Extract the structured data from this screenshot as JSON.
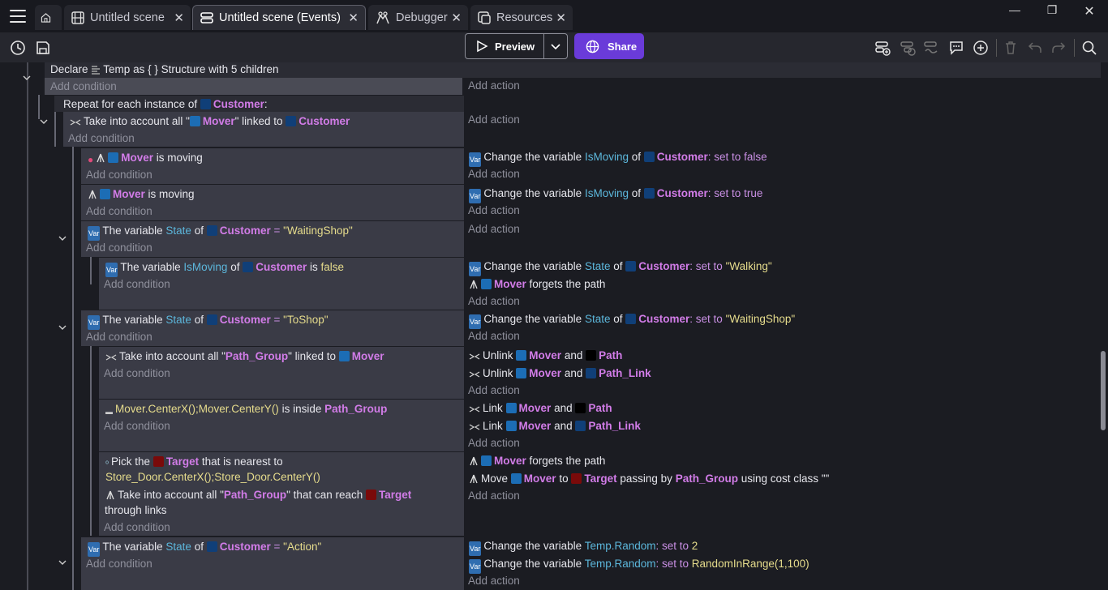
{
  "tabs": [
    {
      "label": "Untitled scene"
    },
    {
      "label": "Untitled scene (Events)"
    },
    {
      "label": "Debugger"
    },
    {
      "label": "Resources"
    }
  ],
  "toolbar": {
    "preview_label": "Preview",
    "share_label": "Share"
  },
  "events": {
    "declare": {
      "prefix": "Declare",
      "name": "Temp",
      "mid": "as",
      "struct": "{ }",
      "suffix": "Structure with 5 children"
    },
    "repeat": {
      "prefix": "Repeat for each instance of",
      "obj": "Customer",
      "suffix": ":"
    },
    "take_all": {
      "prefix": "Take into account all \"",
      "obj1": "Mover",
      "mid": "\" linked to",
      "obj2": "Customer"
    },
    "add_condition": "Add condition",
    "add_action": "Add action",
    "rows": {
      "r1": {
        "cond_obj": "Mover",
        "cond_text": "is moving",
        "act_prefix": "Change the variable",
        "act_var": "IsMoving",
        "act_of": "of",
        "act_obj": "Customer",
        "act_set": ": set to false"
      },
      "r2": {
        "cond_obj": "Mover",
        "cond_text": "is moving",
        "act_prefix": "Change the variable",
        "act_var": "IsMoving",
        "act_of": "of",
        "act_obj": "Customer",
        "act_set": ": set to true"
      },
      "r3": {
        "cond_prefix": "The variable",
        "cond_var": "State",
        "cond_of": "of",
        "cond_obj": "Customer",
        "cond_eq": "=",
        "cond_val": "\"WaitingShop\""
      },
      "r4": {
        "cond_prefix": "The variable",
        "cond_var": "IsMoving",
        "cond_of": "of",
        "cond_obj": "Customer",
        "cond_is": "is",
        "cond_val": "false",
        "act1_prefix": "Change the variable",
        "act1_var": "State",
        "act1_of": "of",
        "act1_obj": "Customer",
        "act1_set": ": set to",
        "act1_val": "\"Walking\"",
        "act2_obj": "Mover",
        "act2_text": "forgets the path"
      },
      "r5": {
        "cond_prefix": "The variable",
        "cond_var": "State",
        "cond_of": "of",
        "cond_obj": "Customer",
        "cond_eq": "=",
        "cond_val": "\"ToShop\"",
        "act_prefix": "Change the variable",
        "act_var": "State",
        "act_of": "of",
        "act_obj": "Customer",
        "act_set": ": set to",
        "act_val": "\"WaitingShop\""
      },
      "r6": {
        "cond_prefix": "Take into account all \"",
        "cond_obj1": "Path_Group",
        "cond_mid": "\" linked to",
        "cond_obj2": "Mover",
        "a1_prefix": "Unlink",
        "a1_obj1": "Mover",
        "a1_and": "and",
        "a1_obj2": "Path",
        "a2_prefix": "Unlink",
        "a2_obj1": "Mover",
        "a2_and": "and",
        "a2_obj2": "Path_Link"
      },
      "r7": {
        "cond_expr": "Mover.CenterX();Mover.CenterY()",
        "cond_mid": "is inside",
        "cond_obj": "Path_Group",
        "a1_prefix": "Link",
        "a1_obj1": "Mover",
        "a1_and": "and",
        "a1_obj2": "Path",
        "a2_prefix": "Link",
        "a2_obj1": "Mover",
        "a2_and": "and",
        "a2_obj2": "Path_Link"
      },
      "r8": {
        "c1_prefix": "Pick the",
        "c1_obj": "Target",
        "c1_mid": "that is nearest to",
        "c1_expr": "Store_Door.CenterX();Store_Door.CenterY()",
        "c2_prefix": "Take into account all \"",
        "c2_obj1": "Path_Group",
        "c2_mid": "\" that can reach",
        "c2_obj2": "Target",
        "c2_suffix": "through links",
        "a1_obj": "Mover",
        "a1_text": "forgets the path",
        "a2_prefix": "Move",
        "a2_obj1": "Mover",
        "a2_to": "to",
        "a2_obj2": "Target",
        "a2_mid": "passing by",
        "a2_obj3": "Path_Group",
        "a2_suffix": "using cost class \"\""
      },
      "r9": {
        "cond_prefix": "The variable",
        "cond_var": "State",
        "cond_of": "of",
        "cond_obj": "Customer",
        "cond_eq": "=",
        "cond_val": "\"Action\"",
        "a1_prefix": "Change the variable",
        "a1_var": "Temp.Random",
        "a1_set": ": set to",
        "a1_val": "2",
        "a2_prefix": "Change the variable",
        "a2_var": "Temp.Random",
        "a2_set": ": set to",
        "a2_val": "RandomInRange(1,100)"
      }
    }
  },
  "colors": {
    "accent": "#6a3bd9",
    "object": "#d27ce8",
    "variable": "#5cb7dc",
    "value": "#e6dc8c"
  }
}
